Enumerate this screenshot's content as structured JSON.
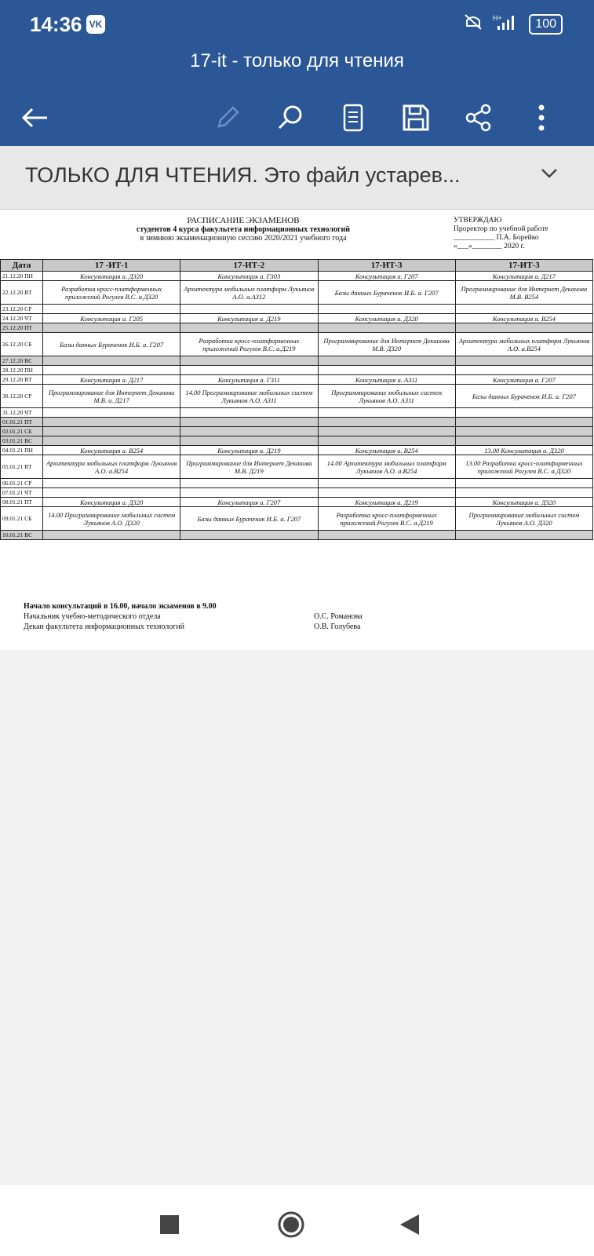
{
  "status": {
    "time": "14:36",
    "vk": "VK",
    "battery": "100",
    "network": "H+"
  },
  "app": {
    "title": "17-it - только для чтения"
  },
  "banner": {
    "text": "ТОЛЬКО ДЛЯ ЧТЕНИЯ. Это файл устарев..."
  },
  "doc": {
    "title": "РАСПИСАНИЕ ЭКЗАМЕНОВ",
    "subtitle1": "студентов 4 курса факультета информационных технологий",
    "subtitle2": "в зимнюю экзаменационную сессию 2020/2021 учебного года",
    "approve1": "УТВЕРЖДАЮ",
    "approve2": "Проректор по учебной работе",
    "approve3": "___________ П.А. Борейко",
    "approve4": "«___»________ 2020 г.",
    "headers": [
      "Дата",
      "17 -ИТ-1",
      "17-ИТ-2",
      "17-ИТ-3",
      "17-ИТ-3"
    ],
    "rows": [
      {
        "d": "21.12.20 ПН",
        "c": [
          "Консультация а. Д320",
          "Консультация а. Г303",
          "Консультация а. Г207",
          "Консультация а. Д217"
        ]
      },
      {
        "d": "22.12.20 ВТ",
        "c": [
          "Разработка кросс-платформенных приложений Рогулев В.С. а.Д320",
          "Архитектура мобильных платформ Лукьянов А.О. а.А312",
          "Базы данных Бураченок И.Б. а. Г207",
          "Программирование для Интернет Деканова М.В. В254"
        ]
      },
      {
        "d": "23.12.20 СР",
        "c": [
          "",
          "",
          "",
          ""
        ]
      },
      {
        "d": "24.12.20 ЧТ",
        "c": [
          "Консультация а. Г205",
          "Консультация а. Д219",
          "Консультация а. Д320",
          "Консультация а. В254"
        ]
      },
      {
        "d": "25.12.20 ПТ",
        "c": [
          "",
          "",
          "",
          ""
        ],
        "gray": true
      },
      {
        "d": "26.12.20 СБ",
        "c": [
          "Базы данных Бураченок И.Б. а. Г207",
          "Разработка кросс-платформенных приложений Рогулев В.С. а.Д219",
          "Программирование для Интернет Деканова М.В. Д320",
          "Архитектура мобильных платформ Лукьянов А.О. а.В254"
        ]
      },
      {
        "d": "27.12.20 ВС",
        "c": [
          "",
          "",
          "",
          ""
        ],
        "gray": true
      },
      {
        "d": "28.12.20 ПН",
        "c": [
          "",
          "",
          "",
          ""
        ]
      },
      {
        "d": "29.12.20 ВТ",
        "c": [
          "Консультация а. Д217",
          "Консультация а. Г311",
          "Консультация а. А311",
          "Консультация а. Г207"
        ]
      },
      {
        "d": "30.12.20 СР",
        "c": [
          "Программирование для Интернет Деканова М.В. а. Д217",
          "14.00 Программирование мобильных систем Лукьянов А.О. А311",
          "Программирование мобильных систем Лукьянов А.О. А311",
          "Базы данных Бураченок И.Б. а. Г207"
        ]
      },
      {
        "d": "31.12.20 ЧТ",
        "c": [
          "",
          "",
          "",
          ""
        ]
      },
      {
        "d": "01.01.21 ПТ",
        "c": [
          "",
          "",
          "",
          ""
        ],
        "gray": true
      },
      {
        "d": "02.01.21 СБ",
        "c": [
          "",
          "",
          "",
          ""
        ],
        "gray": true
      },
      {
        "d": "03.01.21 ВС",
        "c": [
          "",
          "",
          "",
          ""
        ],
        "gray": true
      },
      {
        "d": "04.01.21 ПН",
        "c": [
          "Консультация а. В254",
          "Консультация а. Д219",
          "Консультация а. В254",
          "13.00 Консультация а. Д320"
        ]
      },
      {
        "d": "05.01.21 ВТ",
        "c": [
          "Архитектура мобильных платформ Лукьянов А.О. а.В254",
          "Программирование для Интернет Деканова М.В. Д219",
          "14.00 Архитектура мобильных платформ Лукьянов А.О. а.В254",
          "13.00 Разработка кросс-платформенных приложений Рогулев В.С. а.Д320"
        ]
      },
      {
        "d": "06.01.21 СР",
        "c": [
          "",
          "",
          "",
          ""
        ]
      },
      {
        "d": "07.01.21 ЧТ",
        "c": [
          "",
          "",
          "",
          ""
        ]
      },
      {
        "d": "08.01.21 ПТ",
        "c": [
          "Консультация а. Д320",
          "Консультация а. Г207",
          "Консультация а. Д219",
          "Консультация а. Д320"
        ]
      },
      {
        "d": "09.01.21 СБ",
        "c": [
          "14.00 Программирование мобильных систем Лукьянов А.О. Д320",
          "Базы данных Бураченок И.Б. а. Г207",
          "Разработка кросс-платформенных приложений Рогулев В.С. а.Д219",
          "Программирование мобильных систем Лукьянов А.О. Д320"
        ]
      },
      {
        "d": "10.01.21 ВС",
        "c": [
          "",
          "",
          "",
          ""
        ],
        "gray": true
      }
    ],
    "foot1": "Начало консультаций в 16.00, начало экзаменов в 9.00",
    "foot2": "Начальник учебно-методического отдела",
    "foot2r": "О.С. Романова",
    "foot3": "Декан факультета информационных технологий",
    "foot3r": "О.В. Голубева"
  },
  "icons": [
    "back-arrow-icon",
    "pencil-icon",
    "search-icon",
    "reader-icon",
    "save-icon",
    "share-icon",
    "more-vert-icon",
    "chevron-down-icon"
  ],
  "colors": {
    "appbar": "#2b5797",
    "banner": "#e8e8e8"
  }
}
